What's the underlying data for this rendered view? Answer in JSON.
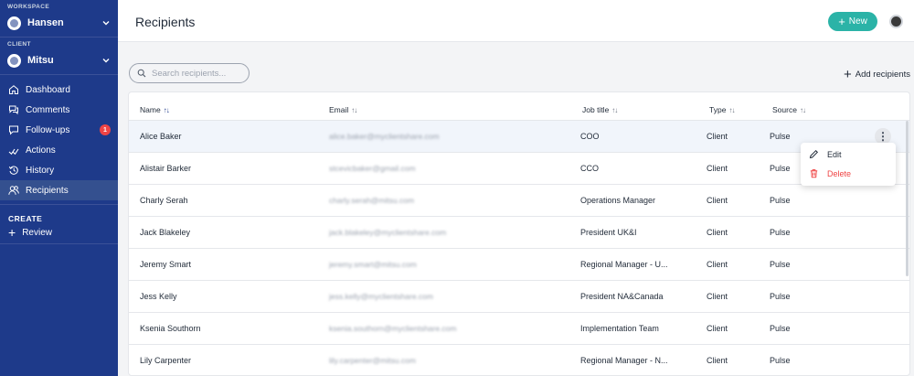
{
  "sidebar": {
    "workspace_label": "WORKSPACE",
    "workspace_name": "Hansen",
    "client_label": "CLIENT",
    "client_name": "Mitsu",
    "nav": [
      {
        "label": "Dashboard",
        "icon": "home-icon"
      },
      {
        "label": "Comments",
        "icon": "comments-icon"
      },
      {
        "label": "Follow-ups",
        "icon": "follow-ups-icon",
        "badge": "1"
      },
      {
        "label": "Actions",
        "icon": "actions-icon"
      },
      {
        "label": "History",
        "icon": "history-icon"
      },
      {
        "label": "Recipients",
        "icon": "recipients-icon",
        "active": true
      }
    ],
    "create_label": "CREATE",
    "create_item": "Review",
    "colors": {
      "background": "#1e3a8a",
      "active": "#34508f",
      "badge": "#ef4444"
    }
  },
  "header": {
    "title": "Recipients",
    "new_button": "New",
    "accent": "#2bb3a7"
  },
  "toolbar": {
    "search_placeholder": "Search recipients...",
    "add_recipients": "Add recipients"
  },
  "table": {
    "columns": [
      "Name",
      "Email",
      "Job title",
      "Type",
      "Source"
    ],
    "rows": [
      {
        "name": "Alice Baker",
        "email": "alice.baker@myclientshare.com",
        "job": "COO",
        "type": "Client",
        "source": "Pulse"
      },
      {
        "name": "Alistair Barker",
        "email": "stcevicbaker@gmail.com",
        "job": "CCO",
        "type": "Client",
        "source": "Pulse"
      },
      {
        "name": "Charly Serah",
        "email": "charly.serah@mitsu.com",
        "job": "Operations Manager",
        "type": "Client",
        "source": "Pulse"
      },
      {
        "name": "Jack Blakeley",
        "email": "jack.blakeley@myclientshare.com",
        "job": "President UK&I",
        "type": "Client",
        "source": "Pulse"
      },
      {
        "name": "Jeremy Smart",
        "email": "jeremy.smart@mitsu.com",
        "job": "Regional Manager - U...",
        "type": "Client",
        "source": "Pulse"
      },
      {
        "name": "Jess Kelly",
        "email": "jess.kelly@myclientshare.com",
        "job": "President NA&Canada",
        "type": "Client",
        "source": "Pulse"
      },
      {
        "name": "Ksenia Southorn",
        "email": "ksenia.southorn@myclientshare.com",
        "job": "Implementation Team",
        "type": "Client",
        "source": "Pulse"
      },
      {
        "name": "Lily Carpenter",
        "email": "lily.carpenter@mitsu.com",
        "job": "Regional Manager - N...",
        "type": "Client",
        "source": "Pulse"
      }
    ]
  },
  "row_menu": {
    "edit": "Edit",
    "delete": "Delete",
    "delete_color": "#ef4444"
  }
}
